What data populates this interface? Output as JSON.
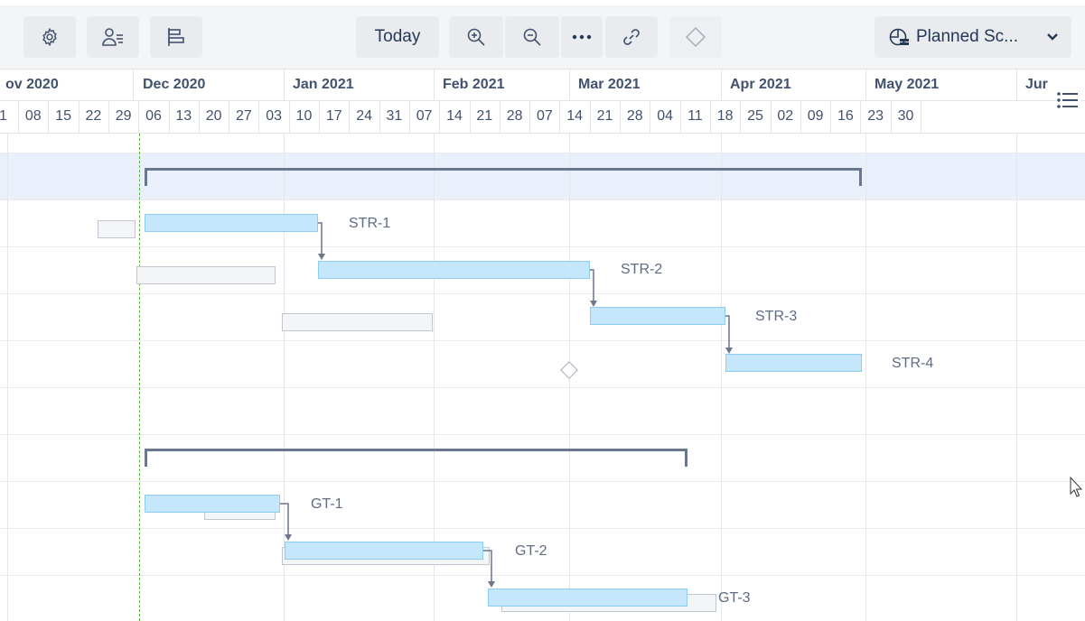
{
  "toolbar": {
    "settings_icon": "gear-icon",
    "people_icon": "users-filter-icon",
    "align_icon": "align-icon",
    "today_label": "Today",
    "zoom_in_icon": "zoom-in-icon",
    "zoom_out_icon": "zoom-out-icon",
    "more_icon": "more-icon",
    "link_icon": "link-icon",
    "milestone_icon": "milestone-icon",
    "scenario_label": "Planned Sc..."
  },
  "timeline": {
    "months": [
      "ov 2020",
      "Dec 2020",
      "Jan 2021",
      "Feb 2021",
      "Mar 2021",
      "Apr 2021",
      "May 2021",
      "Jur"
    ],
    "weeks": [
      "1",
      "08",
      "15",
      "22",
      "29",
      "06",
      "13",
      "20",
      "27",
      "03",
      "10",
      "17",
      "24",
      "31",
      "07",
      "14",
      "21",
      "28",
      "07",
      "14",
      "21",
      "28",
      "04",
      "11",
      "18",
      "25",
      "02",
      "09",
      "16",
      "23",
      "30"
    ]
  },
  "bars": {
    "str1": "STR-1",
    "str2": "STR-2",
    "str3": "STR-3",
    "str4": "STR-4",
    "gt1": "GT-1",
    "gt2": "GT-2",
    "gt3": "GT-3"
  },
  "colors": {
    "bar_fill": "#c6e6fb",
    "bar_border": "#8ccdf2",
    "today_line": "#5ab33a",
    "highlight_row": "#e9f0fb"
  }
}
